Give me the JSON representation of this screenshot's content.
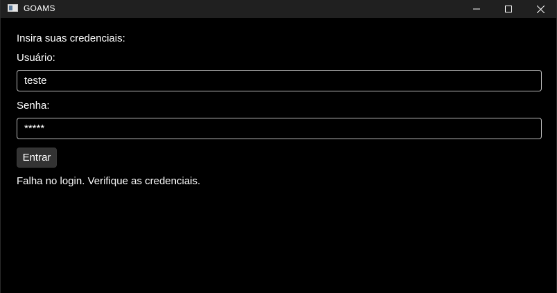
{
  "window": {
    "title": "GOAMS",
    "icon": "app-window-icon"
  },
  "caption_buttons": {
    "minimize_icon": "minimize-icon",
    "maximize_icon": "maximize-icon",
    "close_icon": "close-icon"
  },
  "login": {
    "prompt": "Insira suas credenciais:",
    "username_label": "Usuário:",
    "username_value": "teste",
    "password_label": "Senha:",
    "password_value": "*****",
    "submit_label": "Entrar",
    "status_message": "Falha no login. Verifique as credenciais."
  },
  "colors": {
    "background": "#000000",
    "titlebar": "#202020",
    "field_border": "#bdbdbd",
    "button_bg": "#333333",
    "text": "#ffffff"
  }
}
